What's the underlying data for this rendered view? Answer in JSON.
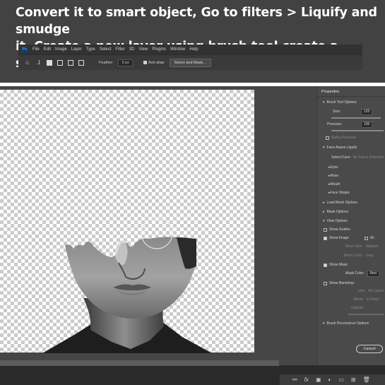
{
  "caption": {
    "line1": "Convert it to smart object, Go to  filters > Liquify and smudge",
    "line2": "it. Create a new layer using brush tool create a shadows"
  },
  "menubar": {
    "logo": "Ps",
    "items": [
      "File",
      "Edit",
      "Image",
      "Layer",
      "Type",
      "Select",
      "Filter",
      "3D",
      "View",
      "Plugins",
      "Window",
      "Help"
    ]
  },
  "options_bar": {
    "feather_label": "Feather:",
    "feather_value": "0 px",
    "anti_alias_label": "Anti-alias",
    "select_mask_label": "Select and Mask..."
  },
  "properties": {
    "title": "Properties",
    "brush_tool_options": "Brush Tool Options",
    "size_label": "Size:",
    "size_value": "125",
    "pressure_label": "Pressure:",
    "pressure_value": "100",
    "stylus_pressure": "Stylus Pressure",
    "face_aware": "Face-Aware Liquify",
    "select_face_label": "Select Face:",
    "select_face_value": "No Faces Detected",
    "eyes": "Eyes",
    "nose": "Nose",
    "mouth": "Mouth",
    "face_shape": "Face Shape",
    "load_mesh": "Load Mesh Options",
    "mask_options": "Mask Options",
    "view_options": "View Options",
    "show_guides": "Show Guides",
    "show_image": "Show Image",
    "show_short": "Sh",
    "mesh_size_label": "Mesh Size:",
    "mesh_size_value": "Medium",
    "mesh_color_label": "Mesh Color:",
    "mesh_color_value": "Gray",
    "show_mask": "Show Mask",
    "mask_color_label": "Mask Color:",
    "mask_color_value": "Red",
    "show_backdrop": "Show Backdrop",
    "use_label": "Use:",
    "use_value": "All Layers",
    "mode_label": "Mode:",
    "mode_value": "In Front",
    "opacity_label": "Opacity:",
    "brush_reconstruct": "Brush Reconstruct Options",
    "cancel_label": "Cancel"
  },
  "bottom_icons": [
    "link-icon",
    "fx-icon",
    "mask-icon",
    "adjustment-icon",
    "group-icon",
    "new-layer-icon",
    "trash-icon"
  ]
}
